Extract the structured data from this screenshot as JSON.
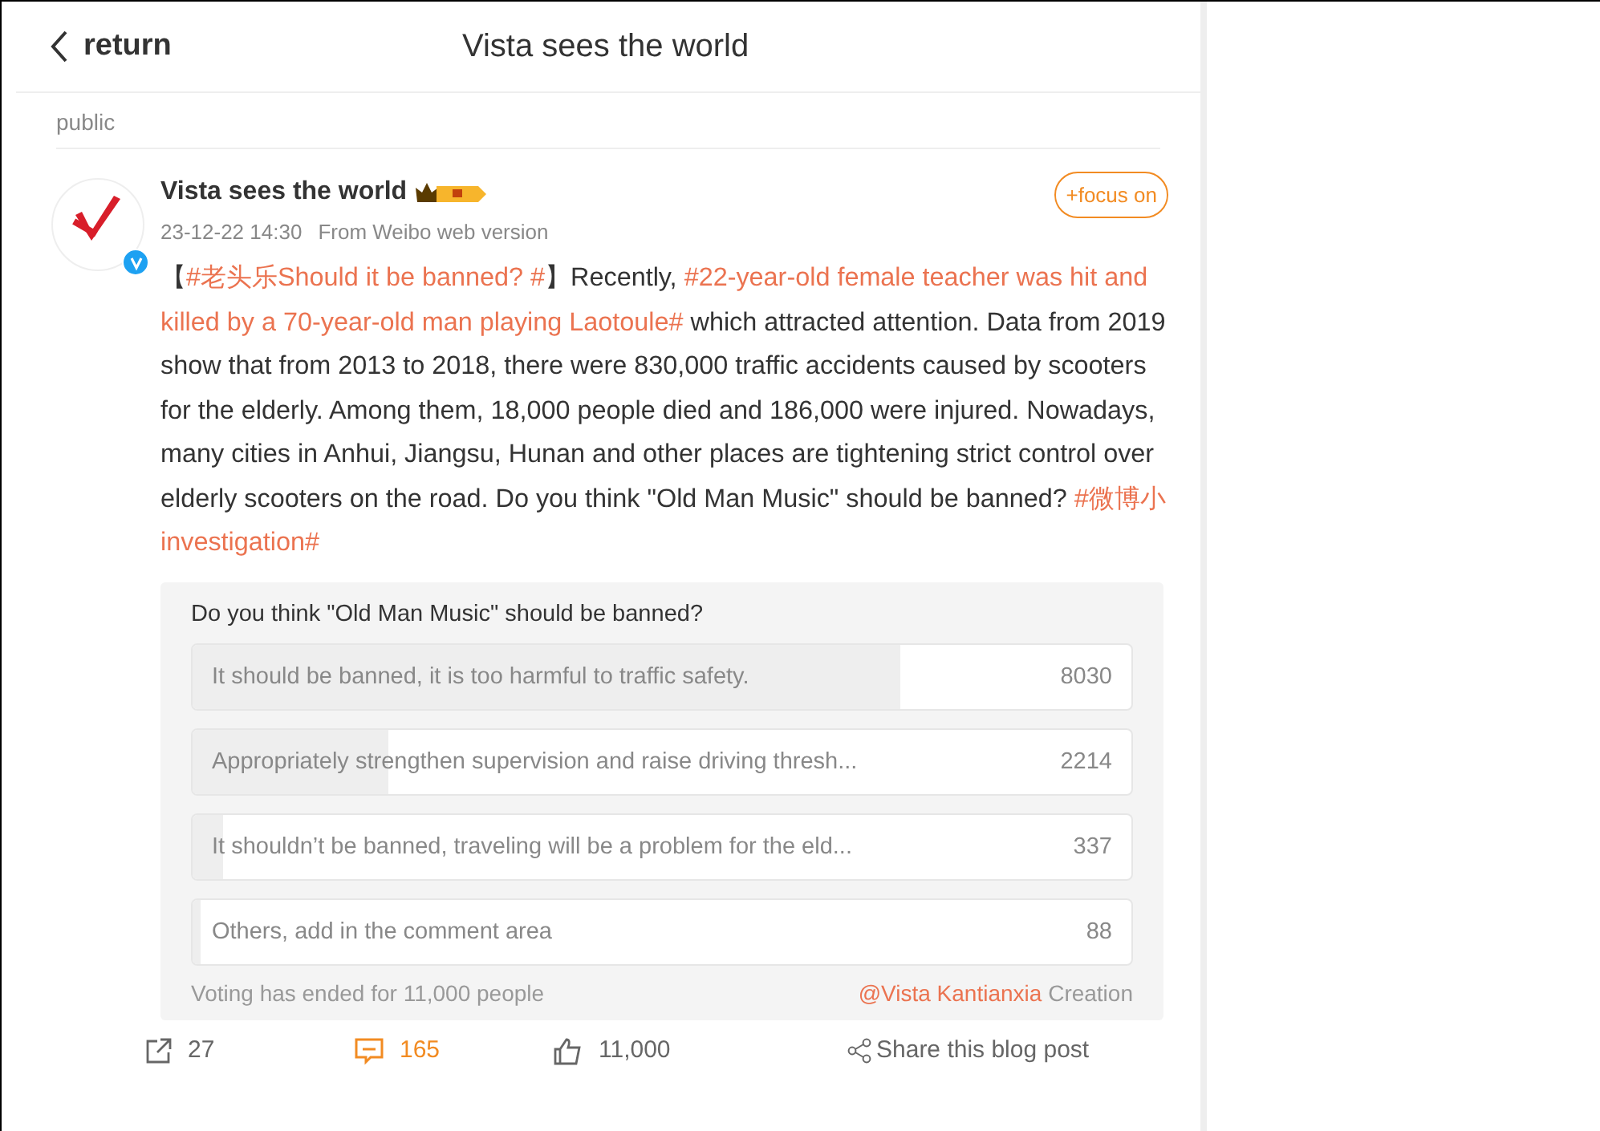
{
  "header": {
    "back_label": "return",
    "title": "Vista sees the world"
  },
  "visibility": "public",
  "post": {
    "author": "Vista sees the world",
    "verified": true,
    "time": "23-12-22 14:30",
    "source": "From Weibo web version",
    "follow_label": "+focus on",
    "body": [
      {
        "kind": "plain",
        "text": "【"
      },
      {
        "kind": "topic",
        "text": "#老头乐Should it be banned? #"
      },
      {
        "kind": "plain",
        "text": "】Recently, "
      },
      {
        "kind": "topic",
        "text": "#22-year-old female teacher was hit and killed by a 70-year-old man playing Laotoule#"
      },
      {
        "kind": "plain",
        "text": " which attracted attention. Data from 2019 show that from 2013 to 2018, there were 830,000 traffic accidents caused by scooters for the elderly. Among them, 18,000 people died and 186,000 were injured. Nowadays, many cities in Anhui, Jiangsu, Hunan and other places are tightening strict control over elderly scooters on the road. Do you think \"Old Man Music\" should be banned? "
      },
      {
        "kind": "topic",
        "text": "#微博小investigation#"
      }
    ],
    "poll": {
      "question": "Do you think \"Old Man Music\" should be banned?",
      "options": [
        {
          "label": "It should be banned, it is too harmful to traffic safety.",
          "count": "8030",
          "level": 0.753
        },
        {
          "label": "Appropriately strengthen supervision and raise driving thresh...",
          "count": "2214",
          "level": 0.208
        },
        {
          "label": "It shouldn’t be banned, traveling will be a problem for the eld...",
          "count": "337",
          "level": 0.032
        },
        {
          "label": "Others, add in the comment area",
          "count": "88",
          "level": 0.008
        }
      ],
      "status": "Voting has ended for 11,000 people",
      "creator": "@Vista Kantianxia",
      "creator_suffix": "Creation"
    },
    "actions": {
      "reposts": "27",
      "comments": "165",
      "likes": "11,000",
      "share": "Share this blog post"
    }
  }
}
